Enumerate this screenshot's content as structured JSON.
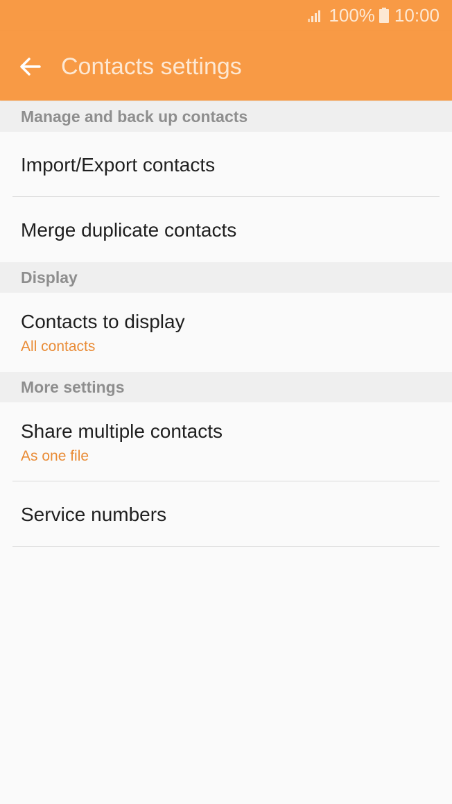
{
  "status_bar": {
    "battery_percent": "100%",
    "time": "10:00",
    "signal_icon": "signal-icon",
    "battery_icon": "battery-icon"
  },
  "app_bar": {
    "title": "Contacts settings",
    "back_icon": "back-arrow-icon",
    "background_color": "#f89a45",
    "text_color": "#fde8d3"
  },
  "sections": {
    "manage": {
      "header": "Manage and back up contacts",
      "items": [
        {
          "title": "Import/Export contacts"
        },
        {
          "title": "Merge duplicate contacts"
        }
      ]
    },
    "display": {
      "header": "Display",
      "items": [
        {
          "title": "Contacts to display",
          "subtitle": "All contacts"
        }
      ]
    },
    "more": {
      "header": "More settings",
      "items": [
        {
          "title": "Share multiple contacts",
          "subtitle": "As one file"
        },
        {
          "title": "Service numbers"
        }
      ]
    }
  },
  "colors": {
    "accent": "#e98b35",
    "section_header_bg": "#efefef",
    "section_header_text": "#8e8e8e"
  }
}
